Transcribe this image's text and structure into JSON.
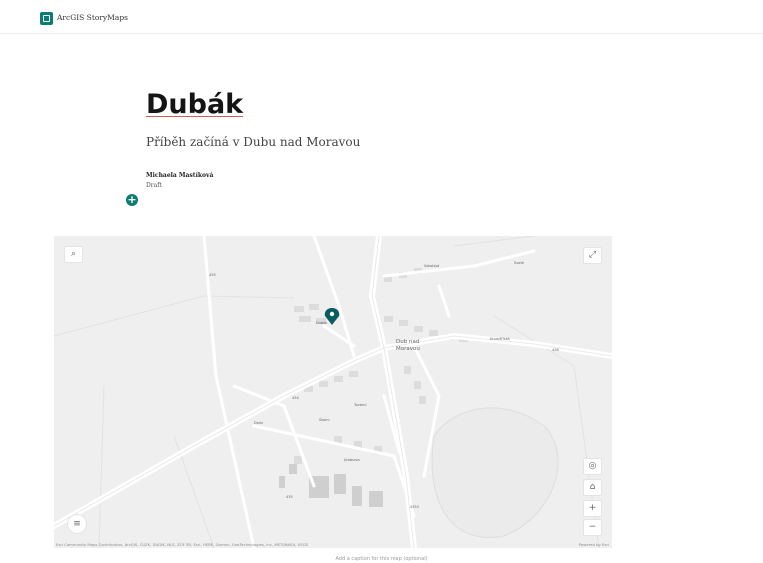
{
  "header": {
    "app_name": "ArcGIS StoryMaps"
  },
  "story": {
    "title": "Dubák",
    "subtitle": "Příběh začíná v Dubu nad Moravou",
    "author": "Michaela Mastíková",
    "status": "Draft",
    "add_block_label": "+"
  },
  "map": {
    "town_label_1": "Dub nad",
    "town_label_2": "Moravou",
    "attribution": "Esri Community Maps Contributors, ArcGIS, ČÚZK, DUGIK, NLS, ZOF SR, Esri, HERE, Garmin, GeoTechnologies, Inc, METI/NASA, USGS",
    "powered_by": "Powered by Esri",
    "caption_placeholder": "Add a caption for this map (optional)",
    "controls": {
      "search_icon": "search-icon",
      "expand_icon": "expand-icon",
      "locate_icon": "locate-icon",
      "home_icon": "home-icon",
      "zoom_in": "+",
      "zoom_out": "−",
      "legend_icon": "legend-icon"
    },
    "accent_color": "#0b7c74"
  }
}
